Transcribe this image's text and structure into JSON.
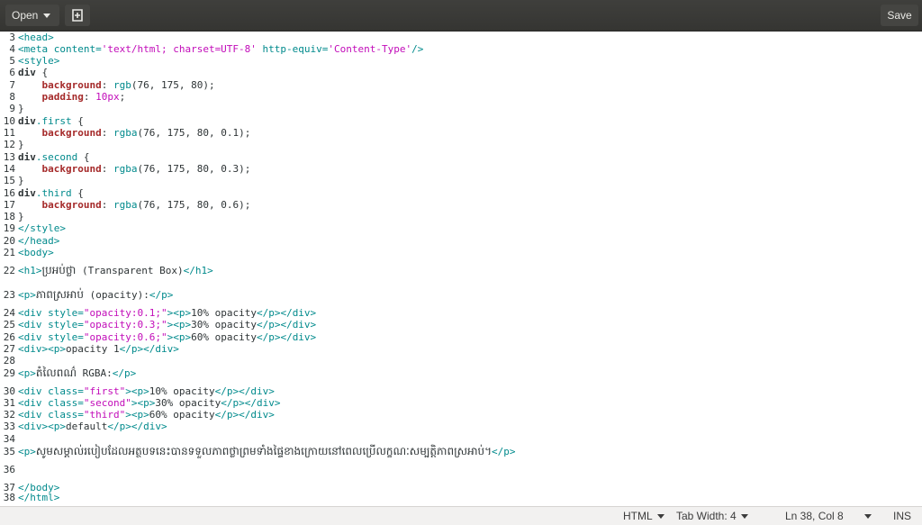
{
  "header": {
    "open_label": "Open",
    "save_label": "Save"
  },
  "lines": [
    {
      "n": "3",
      "segs": [
        [
          "tag",
          "<head>"
        ]
      ]
    },
    {
      "n": "4",
      "segs": [
        [
          "tag",
          "<meta "
        ],
        [
          "attr",
          "content="
        ],
        [
          "str",
          "'text/html; charset=UTF-8'"
        ],
        [
          "attr",
          " http-equiv="
        ],
        [
          "str",
          "'Content-Type'"
        ],
        [
          "tag",
          "/>"
        ]
      ]
    },
    {
      "n": "5",
      "segs": [
        [
          "tag",
          "<style>"
        ]
      ]
    },
    {
      "n": "6",
      "segs": [
        [
          "sel",
          "div"
        ],
        [
          "txt",
          " {"
        ]
      ]
    },
    {
      "n": "7",
      "segs": [
        [
          "txt",
          "    "
        ],
        [
          "kw",
          "background"
        ],
        [
          "txt",
          ": "
        ],
        [
          "fn",
          "rgb"
        ],
        [
          "txt",
          "(76, 175, 80);"
        ]
      ]
    },
    {
      "n": "8",
      "segs": [
        [
          "txt",
          "    "
        ],
        [
          "kw",
          "padding"
        ],
        [
          "txt",
          ": "
        ],
        [
          "num",
          "10px"
        ],
        [
          "txt",
          ";"
        ]
      ]
    },
    {
      "n": "9",
      "segs": [
        [
          "txt",
          "}"
        ]
      ]
    },
    {
      "n": "10",
      "segs": [
        [
          "sel",
          "div"
        ],
        [
          "fn",
          ".first"
        ],
        [
          "txt",
          " {"
        ]
      ]
    },
    {
      "n": "11",
      "segs": [
        [
          "txt",
          "    "
        ],
        [
          "kw",
          "background"
        ],
        [
          "txt",
          ": "
        ],
        [
          "fn",
          "rgba"
        ],
        [
          "txt",
          "(76, 175, 80, 0.1);"
        ]
      ]
    },
    {
      "n": "12",
      "segs": [
        [
          "txt",
          "}"
        ]
      ]
    },
    {
      "n": "13",
      "segs": [
        [
          "sel",
          "div"
        ],
        [
          "fn",
          ".second"
        ],
        [
          "txt",
          " {"
        ]
      ]
    },
    {
      "n": "14",
      "segs": [
        [
          "txt",
          "    "
        ],
        [
          "kw",
          "background"
        ],
        [
          "txt",
          ": "
        ],
        [
          "fn",
          "rgba"
        ],
        [
          "txt",
          "(76, 175, 80, 0.3);"
        ]
      ]
    },
    {
      "n": "15",
      "segs": [
        [
          "txt",
          "}"
        ]
      ]
    },
    {
      "n": "16",
      "segs": [
        [
          "sel",
          "div"
        ],
        [
          "fn",
          ".third"
        ],
        [
          "txt",
          " {"
        ]
      ]
    },
    {
      "n": "17",
      "segs": [
        [
          "txt",
          "    "
        ],
        [
          "kw",
          "background"
        ],
        [
          "txt",
          ": "
        ],
        [
          "fn",
          "rgba"
        ],
        [
          "txt",
          "(76, 175, 80, 0.6);"
        ]
      ]
    },
    {
      "n": "18",
      "segs": [
        [
          "txt",
          "}"
        ]
      ]
    },
    {
      "n": "19",
      "segs": [
        [
          "tag",
          "</style>"
        ]
      ]
    },
    {
      "n": "20",
      "segs": [
        [
          "tag",
          "</head>"
        ]
      ]
    },
    {
      "n": "21",
      "segs": [
        [
          "tag",
          "<body>"
        ]
      ]
    },
    {
      "n": "22",
      "segs": [
        [
          "tag",
          "<h1>"
        ],
        [
          "khmer",
          "ប្រអប់ថ្លា"
        ],
        [
          "txt",
          " (Transparent Box)"
        ],
        [
          "tag",
          "</h1>"
        ]
      ]
    },
    {
      "n": "23",
      "segs": [
        [
          "tag",
          "<p>"
        ],
        [
          "khmer",
          "ភាពស្រអាប់"
        ],
        [
          "txt",
          " (opacity):"
        ],
        [
          "tag",
          "</p>"
        ]
      ]
    },
    {
      "n": "24",
      "segs": [
        [
          "tag",
          "<div "
        ],
        [
          "attr",
          "style="
        ],
        [
          "str",
          "\"opacity:0.1;\""
        ],
        [
          "tag",
          "><p>"
        ],
        [
          "txt",
          "10% opacity"
        ],
        [
          "tag",
          "</p></div>"
        ]
      ]
    },
    {
      "n": "25",
      "segs": [
        [
          "tag",
          "<div "
        ],
        [
          "attr",
          "style="
        ],
        [
          "str",
          "\"opacity:0.3;\""
        ],
        [
          "tag",
          "><p>"
        ],
        [
          "txt",
          "30% opacity"
        ],
        [
          "tag",
          "</p></div>"
        ]
      ]
    },
    {
      "n": "26",
      "segs": [
        [
          "tag",
          "<div "
        ],
        [
          "attr",
          "style="
        ],
        [
          "str",
          "\"opacity:0.6;\""
        ],
        [
          "tag",
          "><p>"
        ],
        [
          "txt",
          "60% opacity"
        ],
        [
          "tag",
          "</p></div>"
        ]
      ]
    },
    {
      "n": "27",
      "segs": [
        [
          "tag",
          "<div><p>"
        ],
        [
          "txt",
          "opacity 1"
        ],
        [
          "tag",
          "</p></div>"
        ]
      ]
    },
    {
      "n": "28",
      "segs": []
    },
    {
      "n": "29",
      "segs": [
        [
          "tag",
          "<p>"
        ],
        [
          "khmer",
          "តំលៃពណ៌"
        ],
        [
          "txt",
          " RGBA:"
        ],
        [
          "tag",
          "</p>"
        ]
      ]
    },
    {
      "n": "30",
      "segs": [
        [
          "tag",
          "<div "
        ],
        [
          "attr",
          "class="
        ],
        [
          "str",
          "\"first\""
        ],
        [
          "tag",
          "><p>"
        ],
        [
          "txt",
          "10% opacity"
        ],
        [
          "tag",
          "</p></div>"
        ]
      ]
    },
    {
      "n": "31",
      "segs": [
        [
          "tag",
          "<div "
        ],
        [
          "attr",
          "class="
        ],
        [
          "str",
          "\"second\""
        ],
        [
          "tag",
          "><p>"
        ],
        [
          "txt",
          "30% opacity"
        ],
        [
          "tag",
          "</p></div>"
        ]
      ]
    },
    {
      "n": "32",
      "segs": [
        [
          "tag",
          "<div "
        ],
        [
          "attr",
          "class="
        ],
        [
          "str",
          "\"third\""
        ],
        [
          "tag",
          "><p>"
        ],
        [
          "txt",
          "60% opacity"
        ],
        [
          "tag",
          "</p></div>"
        ]
      ]
    },
    {
      "n": "33",
      "segs": [
        [
          "tag",
          "<div><p>"
        ],
        [
          "txt",
          "default"
        ],
        [
          "tag",
          "</p></div>"
        ]
      ]
    },
    {
      "n": "34",
      "segs": []
    },
    {
      "n": "35",
      "segs": [
        [
          "tag",
          "<p>"
        ],
        [
          "khmer",
          "សូមសម្គាល់របៀបដែលអត្ថបទនេះបានទទួលភាពថ្លាព្រមទាំងផ្ទៃខាងក្រោយនៅពេលប្រើលក្ខណៈសម្បត្តិភាពស្រអាប់។"
        ],
        [
          "tag",
          "</p>"
        ]
      ]
    },
    {
      "n": "36",
      "segs": []
    },
    {
      "n": "37",
      "segs": [
        [
          "tag",
          "</body>"
        ]
      ]
    },
    {
      "n": "38",
      "segs": [
        [
          "tag",
          "</html>"
        ]
      ]
    }
  ],
  "status": {
    "language": "HTML",
    "tab_width": "Tab Width: 4",
    "position": "Ln 38, Col 8",
    "mode": "INS"
  }
}
